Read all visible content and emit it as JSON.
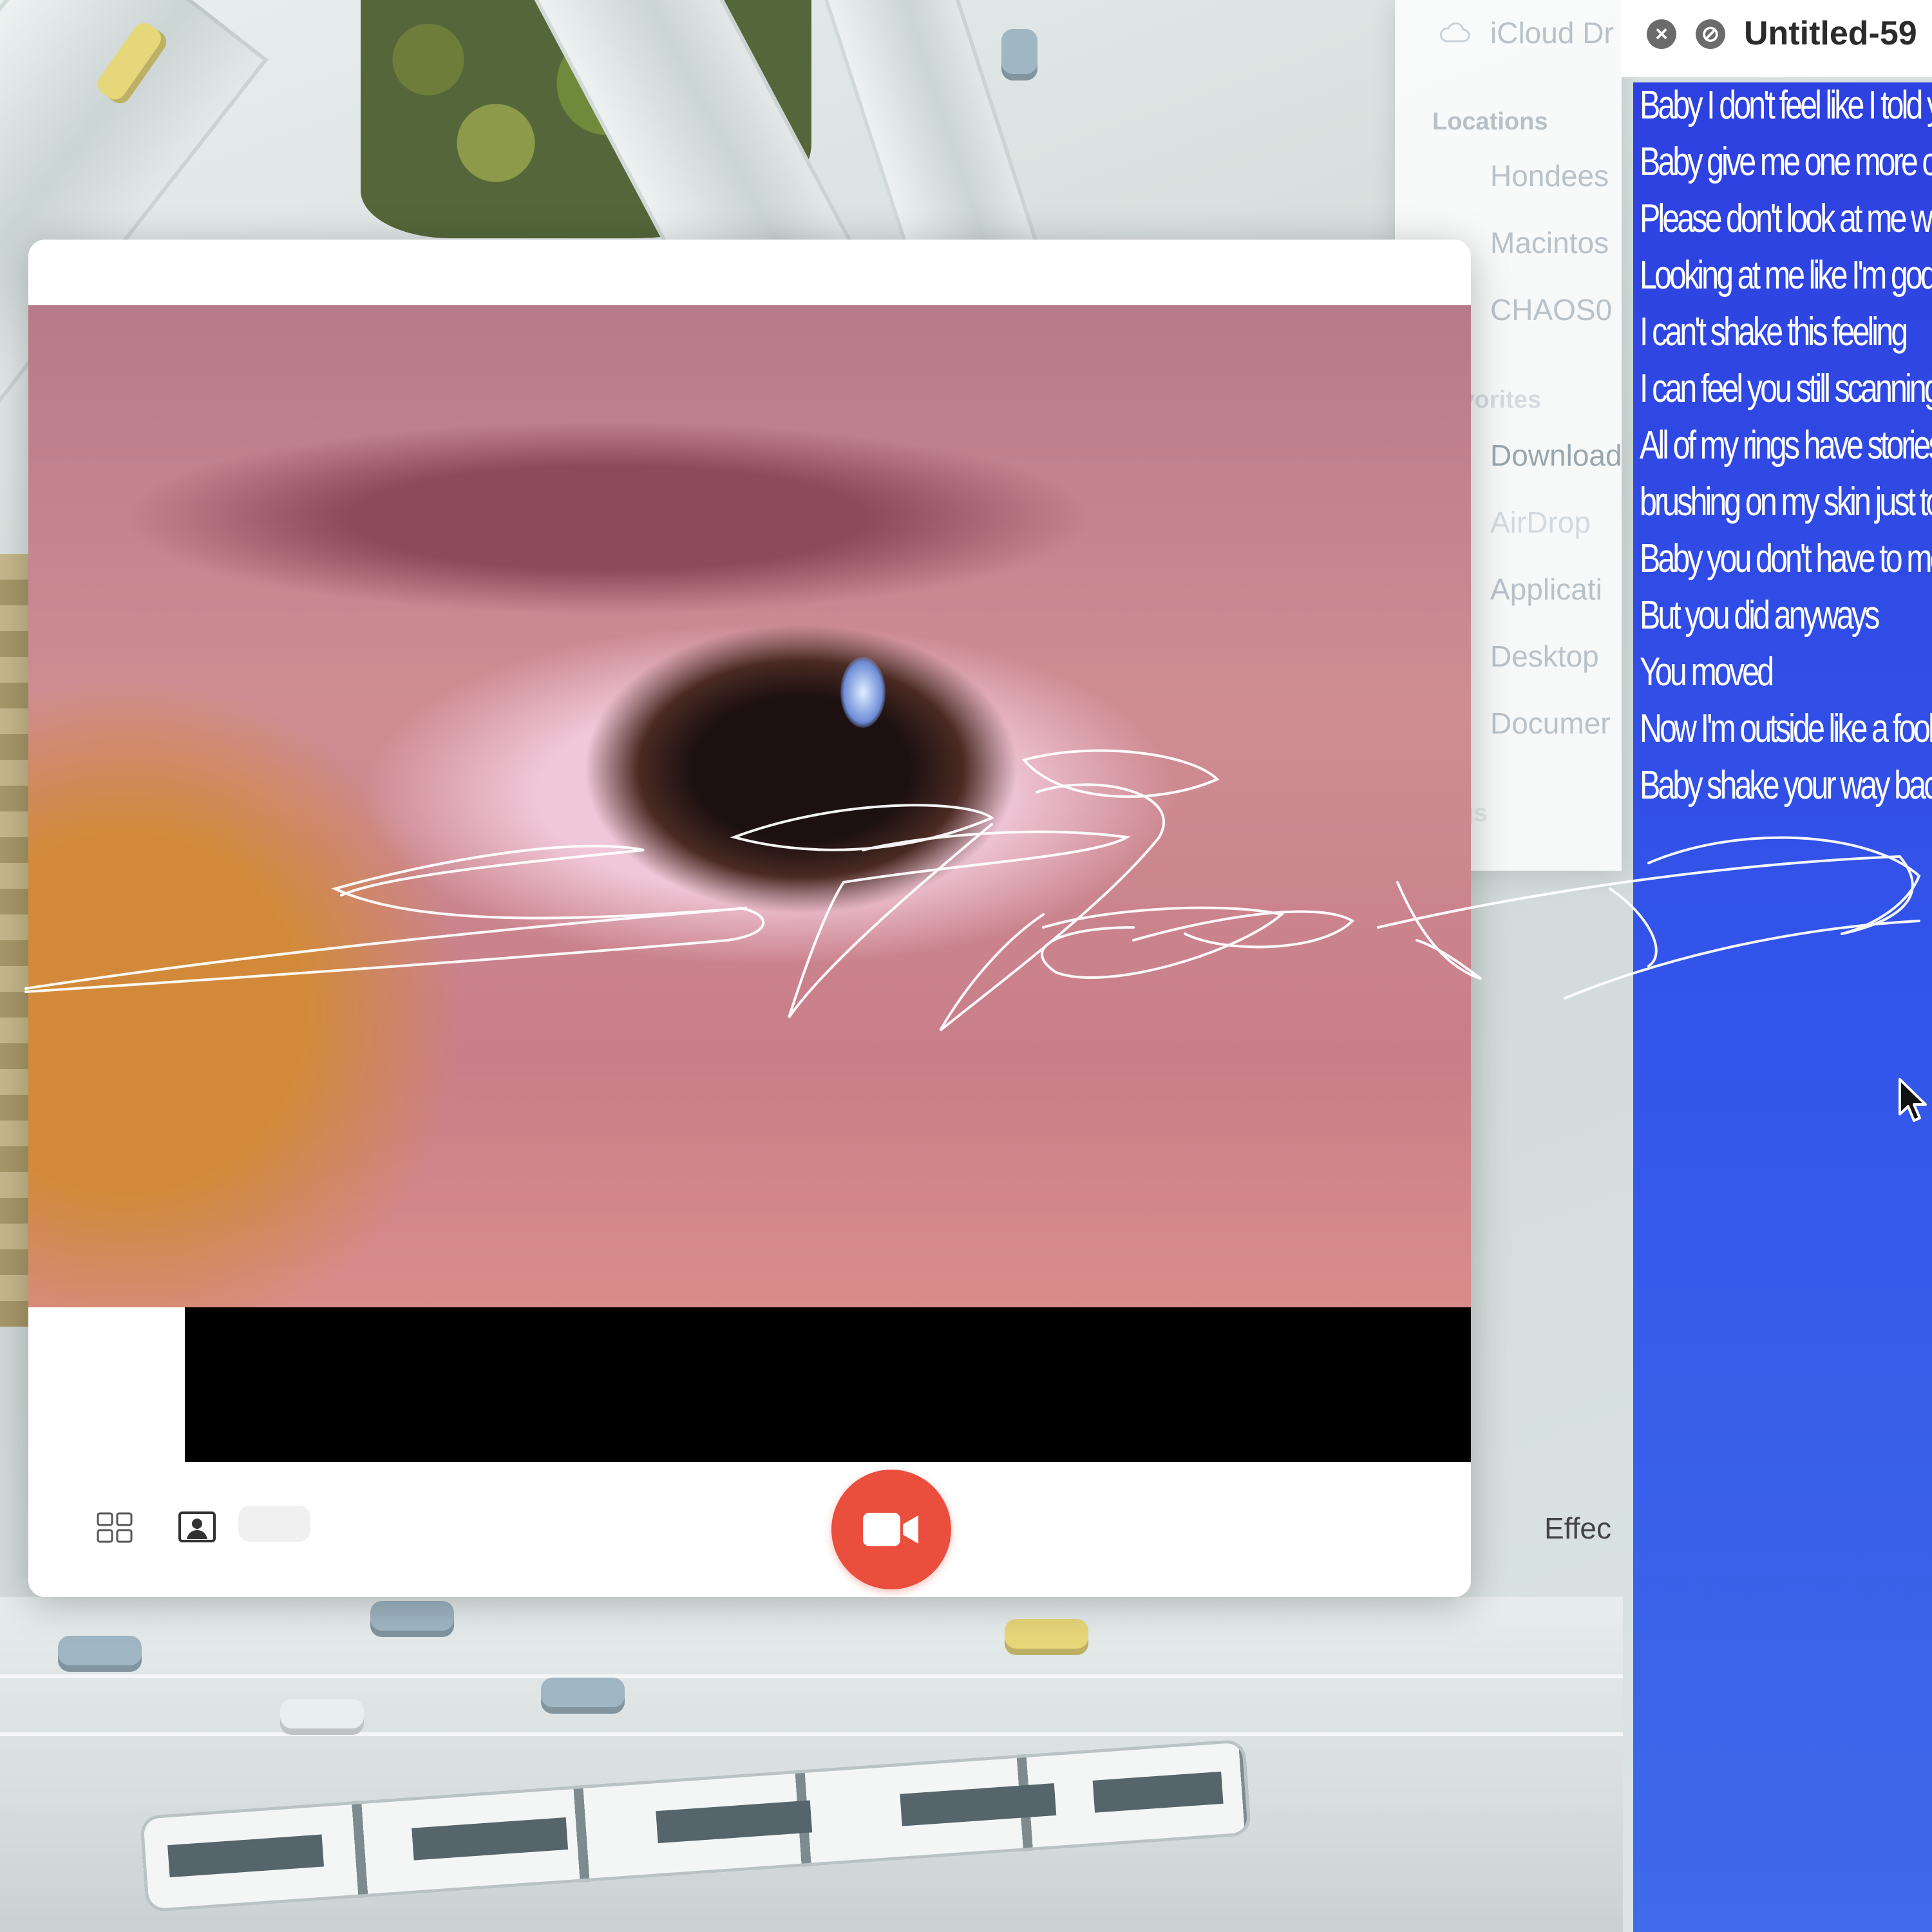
{
  "finder_sidebar": {
    "top_item": "iCloud Dr",
    "sections": {
      "locations": "Locations",
      "favorites": "Favorites",
      "tags": "Tags"
    },
    "locations": [
      "Hondees",
      "Macintos",
      "CHAOS0"
    ],
    "favorites": [
      "Download",
      "AirDrop",
      "Applicati",
      "Desktop",
      "Documer"
    ],
    "icons": [
      "cloud-icon",
      "download-icon",
      "airdrop-icon",
      "applications-icon",
      "desktop-icon",
      "document-icon"
    ]
  },
  "text_editor": {
    "title": "Untitled-59",
    "lyrics": [
      "Baby I don't feel like I told you w",
      "Baby give me one more chan",
      "Please don't look at me with th",
      "Looking at me like I'm god",
      "I can't shake this feeling",
      "I can feel you still scanning me",
      "All of my rings have stories too",
      "brushing on my skin just to fee",
      "Baby you don't have to move",
      "But you did anyways",
      "You moved",
      "Now I'm outside like a fool now",
      "Baby shake your way back"
    ],
    "background_color": "#3355ea"
  },
  "photo_booth": {
    "effects_label": "Effec",
    "record_color": "#ea4e3d",
    "icons": [
      "grid-view-icon",
      "single-photo-icon",
      "video-camera-icon"
    ]
  }
}
